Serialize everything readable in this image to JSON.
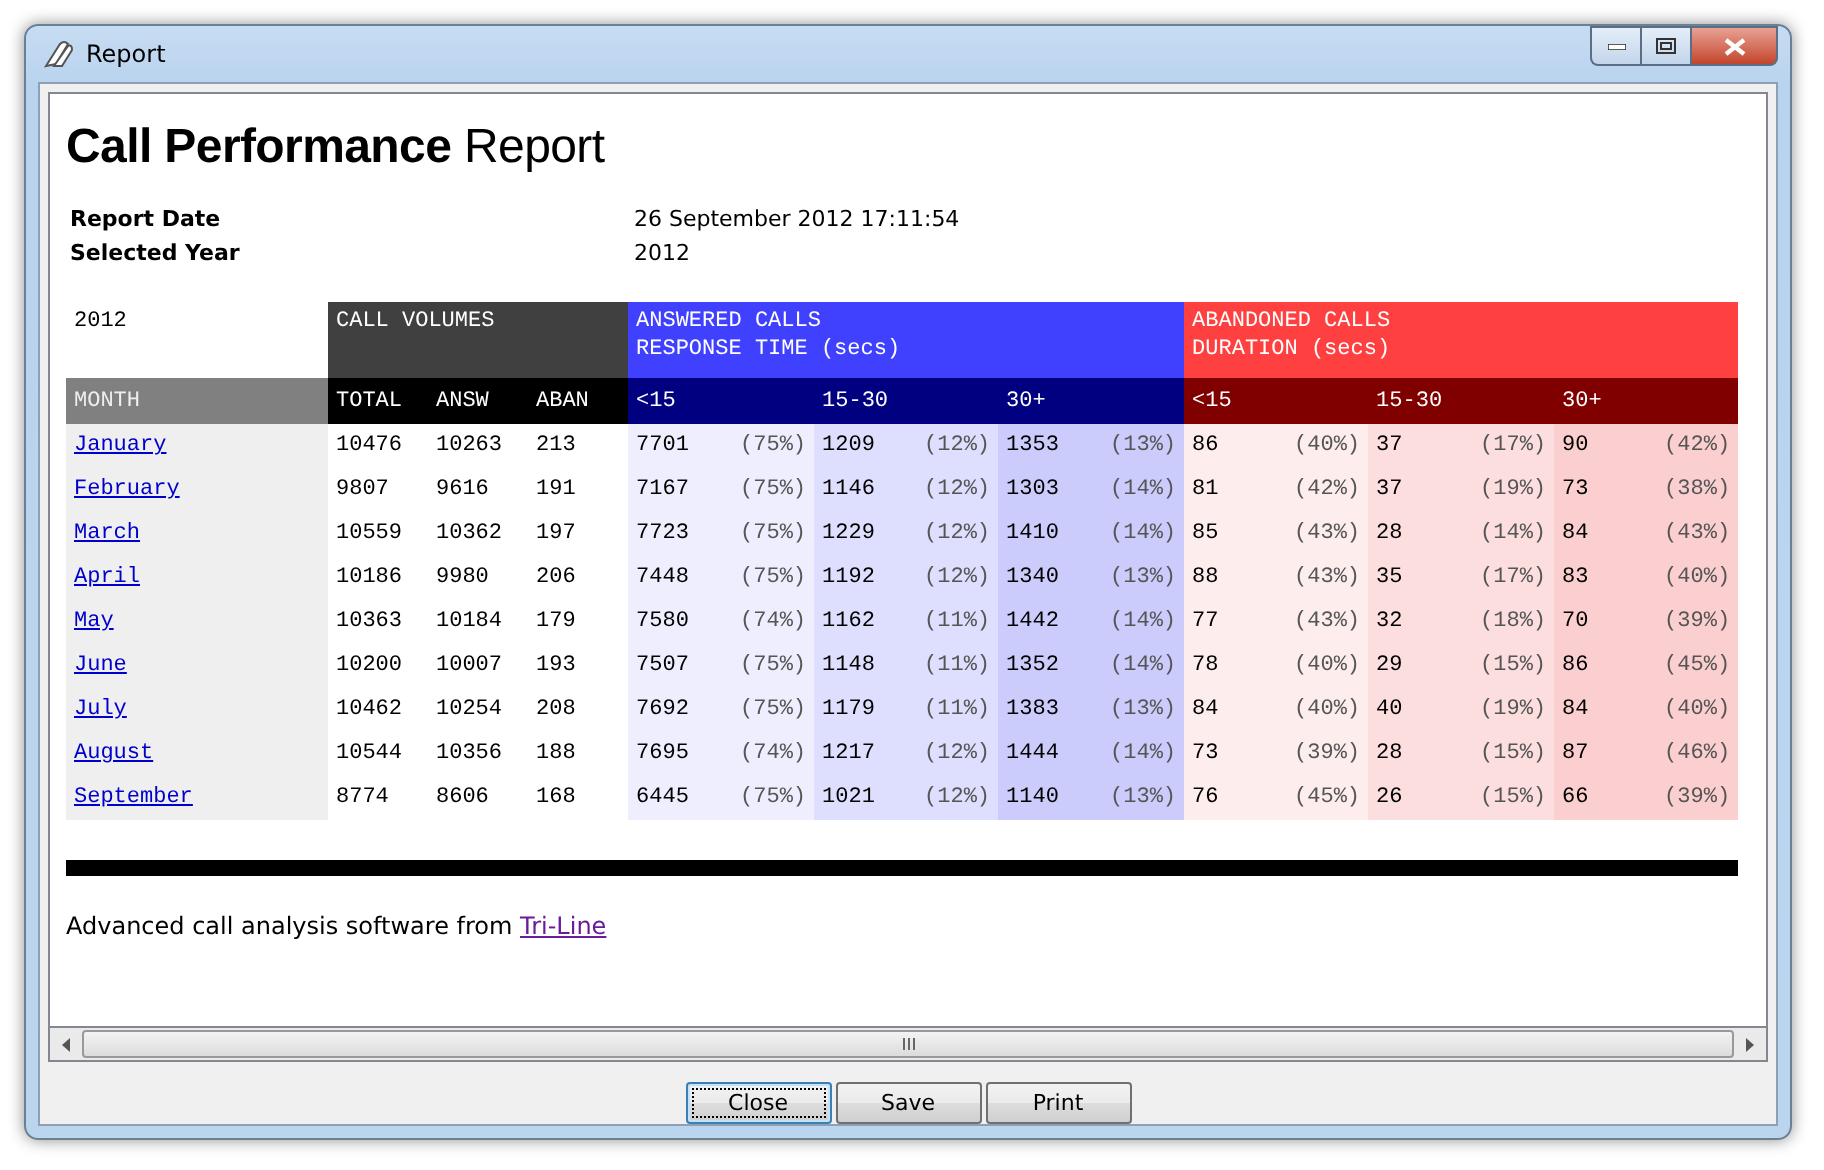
{
  "window": {
    "title": "Report"
  },
  "report": {
    "title": "**Call Performance** Report",
    "meta": [
      {
        "label": "Report Date",
        "value": "26 September 2012 17:11:54"
      },
      {
        "label": "Selected Year",
        "value": "2012"
      }
    ],
    "table": {
      "year": "2012",
      "month_header": "MONTH",
      "groups": [
        {
          "lines": [
            "CALL VOLUMES"
          ],
          "columns": [
            "TOTAL",
            "ANSW",
            "ABAN"
          ]
        },
        {
          "lines": [
            "ANSWERED CALLS",
            "RESPONSE TIME (secs)"
          ],
          "columns": [
            "<15",
            "15-30",
            "30+"
          ]
        },
        {
          "lines": [
            "ABANDONED CALLS",
            "DURATION (secs)"
          ],
          "columns": [
            "<15",
            "15-30",
            "30+"
          ]
        }
      ],
      "rows": [
        {
          "month": "January",
          "volumes": [
            "10476",
            "10263",
            "213"
          ],
          "answered": [
            [
              "7701",
              "(75%)"
            ],
            [
              "1209",
              "(12%)"
            ],
            [
              "1353",
              "(13%)"
            ]
          ],
          "abandoned": [
            [
              "86",
              "(40%)"
            ],
            [
              "37",
              "(17%)"
            ],
            [
              "90",
              "(42%)"
            ]
          ]
        },
        {
          "month": "February",
          "volumes": [
            "9807",
            "9616",
            "191"
          ],
          "answered": [
            [
              "7167",
              "(75%)"
            ],
            [
              "1146",
              "(12%)"
            ],
            [
              "1303",
              "(14%)"
            ]
          ],
          "abandoned": [
            [
              "81",
              "(42%)"
            ],
            [
              "37",
              "(19%)"
            ],
            [
              "73",
              "(38%)"
            ]
          ]
        },
        {
          "month": "March",
          "volumes": [
            "10559",
            "10362",
            "197"
          ],
          "answered": [
            [
              "7723",
              "(75%)"
            ],
            [
              "1229",
              "(12%)"
            ],
            [
              "1410",
              "(14%)"
            ]
          ],
          "abandoned": [
            [
              "85",
              "(43%)"
            ],
            [
              "28",
              "(14%)"
            ],
            [
              "84",
              "(43%)"
            ]
          ]
        },
        {
          "month": "April",
          "volumes": [
            "10186",
            "9980",
            "206"
          ],
          "answered": [
            [
              "7448",
              "(75%)"
            ],
            [
              "1192",
              "(12%)"
            ],
            [
              "1340",
              "(13%)"
            ]
          ],
          "abandoned": [
            [
              "88",
              "(43%)"
            ],
            [
              "35",
              "(17%)"
            ],
            [
              "83",
              "(40%)"
            ]
          ]
        },
        {
          "month": "May",
          "volumes": [
            "10363",
            "10184",
            "179"
          ],
          "answered": [
            [
              "7580",
              "(74%)"
            ],
            [
              "1162",
              "(11%)"
            ],
            [
              "1442",
              "(14%)"
            ]
          ],
          "abandoned": [
            [
              "77",
              "(43%)"
            ],
            [
              "32",
              "(18%)"
            ],
            [
              "70",
              "(39%)"
            ]
          ]
        },
        {
          "month": "June",
          "volumes": [
            "10200",
            "10007",
            "193"
          ],
          "answered": [
            [
              "7507",
              "(75%)"
            ],
            [
              "1148",
              "(11%)"
            ],
            [
              "1352",
              "(14%)"
            ]
          ],
          "abandoned": [
            [
              "78",
              "(40%)"
            ],
            [
              "29",
              "(15%)"
            ],
            [
              "86",
              "(45%)"
            ]
          ]
        },
        {
          "month": "July",
          "volumes": [
            "10462",
            "10254",
            "208"
          ],
          "answered": [
            [
              "7692",
              "(75%)"
            ],
            [
              "1179",
              "(11%)"
            ],
            [
              "1383",
              "(13%)"
            ]
          ],
          "abandoned": [
            [
              "84",
              "(40%)"
            ],
            [
              "40",
              "(19%)"
            ],
            [
              "84",
              "(40%)"
            ]
          ]
        },
        {
          "month": "August",
          "volumes": [
            "10544",
            "10356",
            "188"
          ],
          "answered": [
            [
              "7695",
              "(74%)"
            ],
            [
              "1217",
              "(12%)"
            ],
            [
              "1444",
              "(14%)"
            ]
          ],
          "abandoned": [
            [
              "73",
              "(39%)"
            ],
            [
              "28",
              "(15%)"
            ],
            [
              "87",
              "(46%)"
            ]
          ]
        },
        {
          "month": "September",
          "volumes": [
            "8774",
            "8606",
            "168"
          ],
          "answered": [
            [
              "6445",
              "(75%)"
            ],
            [
              "1021",
              "(12%)"
            ],
            [
              "1140",
              "(13%)"
            ]
          ],
          "abandoned": [
            [
              "76",
              "(45%)"
            ],
            [
              "26",
              "(15%)"
            ],
            [
              "66",
              "(39%)"
            ]
          ]
        }
      ]
    },
    "footer": {
      "text": "Advanced call analysis software from ",
      "link": "Tri-Line"
    }
  },
  "buttons": [
    {
      "label": "Close",
      "focused": true
    },
    {
      "label": "Save",
      "focused": false
    },
    {
      "label": "Print",
      "focused": false
    }
  ]
}
